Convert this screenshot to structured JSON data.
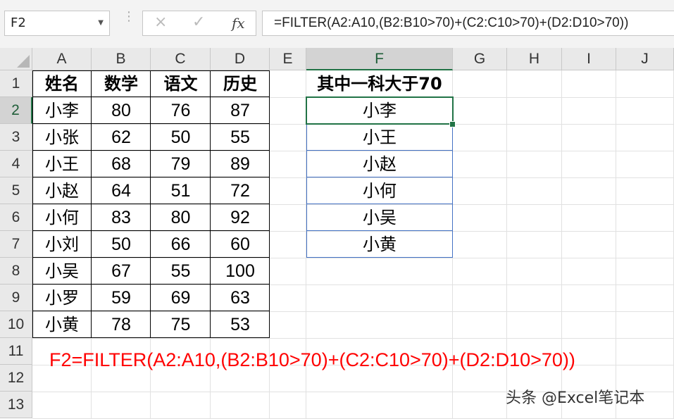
{
  "formula_bar": {
    "name_box": "F2",
    "cancel_icon": "×",
    "enter_icon": "✓",
    "fx_label": "fx",
    "formula": "=FILTER(A2:A10,(B2:B10>70)+(C2:C10>70)+(D2:D10>70))"
  },
  "columns": [
    "A",
    "B",
    "C",
    "D",
    "E",
    "F",
    "G",
    "H",
    "I",
    "J"
  ],
  "rows": [
    "1",
    "2",
    "3",
    "4",
    "5",
    "6",
    "7",
    "8",
    "9",
    "10",
    "11",
    "12",
    "13"
  ],
  "selected_column": "F",
  "selected_row": "2",
  "table": {
    "headers": [
      "姓名",
      "数学",
      "语文",
      "历史"
    ],
    "rows": [
      [
        "小李",
        "80",
        "76",
        "87"
      ],
      [
        "小张",
        "62",
        "50",
        "55"
      ],
      [
        "小王",
        "68",
        "79",
        "89"
      ],
      [
        "小赵",
        "64",
        "51",
        "72"
      ],
      [
        "小何",
        "83",
        "80",
        "92"
      ],
      [
        "小刘",
        "50",
        "66",
        "60"
      ],
      [
        "小吴",
        "67",
        "55",
        "100"
      ],
      [
        "小罗",
        "59",
        "69",
        "63"
      ],
      [
        "小黄",
        "78",
        "75",
        "53"
      ]
    ]
  },
  "result": {
    "header": "其中一科大于70",
    "values": [
      "小李",
      "小王",
      "小赵",
      "小何",
      "小吴",
      "小黄"
    ]
  },
  "note": "F2=FILTER(A2:A10,(B2:B10>70)+(C2:C10>70)+(D2:D10>70))",
  "watermark": "头条 @Excel笔记本",
  "colors": {
    "accent": "#217346",
    "note": "#ff0000",
    "result_border": "#4472c4"
  }
}
